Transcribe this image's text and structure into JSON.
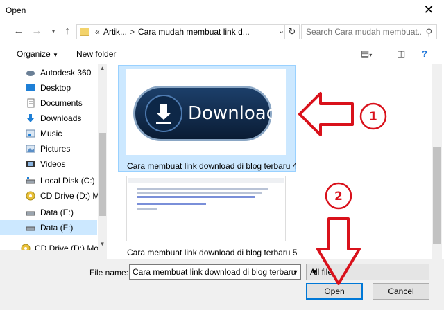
{
  "window": {
    "title": "Open"
  },
  "nav": {
    "back_icon": "back-arrow-icon",
    "forward_icon": "forward-arrow-icon",
    "up_icon": "up-arrow-icon"
  },
  "address": {
    "overflow": "«",
    "crumbs": [
      "Artik...",
      "Cara mudah membuat link d..."
    ],
    "separator": ">"
  },
  "search": {
    "placeholder": "Search Cara mudah membuat..."
  },
  "toolbar": {
    "organize": "Organize",
    "new_folder": "New folder"
  },
  "sidebar": {
    "items": [
      {
        "label": "Autodesk 360",
        "icon": "cloud-icon"
      },
      {
        "label": "Desktop",
        "icon": "desktop-icon"
      },
      {
        "label": "Documents",
        "icon": "documents-icon"
      },
      {
        "label": "Downloads",
        "icon": "downloads-icon"
      },
      {
        "label": "Music",
        "icon": "music-icon"
      },
      {
        "label": "Pictures",
        "icon": "pictures-icon"
      },
      {
        "label": "Videos",
        "icon": "videos-icon"
      },
      {
        "label": "Local Disk (C:)",
        "icon": "disk-icon"
      },
      {
        "label": "CD Drive (D:) Mo",
        "icon": "cd-drive-icon"
      },
      {
        "label": "Data (E:)",
        "icon": "disk-icon"
      },
      {
        "label": "Data (F:)",
        "icon": "disk-icon",
        "selected": true
      },
      {
        "label": "CD Drive (D:) Mob",
        "icon": "cd-drive-icon"
      }
    ]
  },
  "files": [
    {
      "name": "Cara membuat link download di blog terbaru 4",
      "thumb_text": "Download",
      "selected": true
    },
    {
      "name": "Cara membuat link download di blog terbaru 5",
      "selected": false
    }
  ],
  "annotations": {
    "label1": "1",
    "label2": "2",
    "color": "#d9111b"
  },
  "footer": {
    "file_name_label": "File name:",
    "file_name_value": "Cara membuat link download di blog terbaru",
    "file_type": "All file",
    "open": "Open",
    "cancel": "Cancel"
  },
  "colors": {
    "selection": "#cce8ff",
    "accent": "#0078d7"
  }
}
